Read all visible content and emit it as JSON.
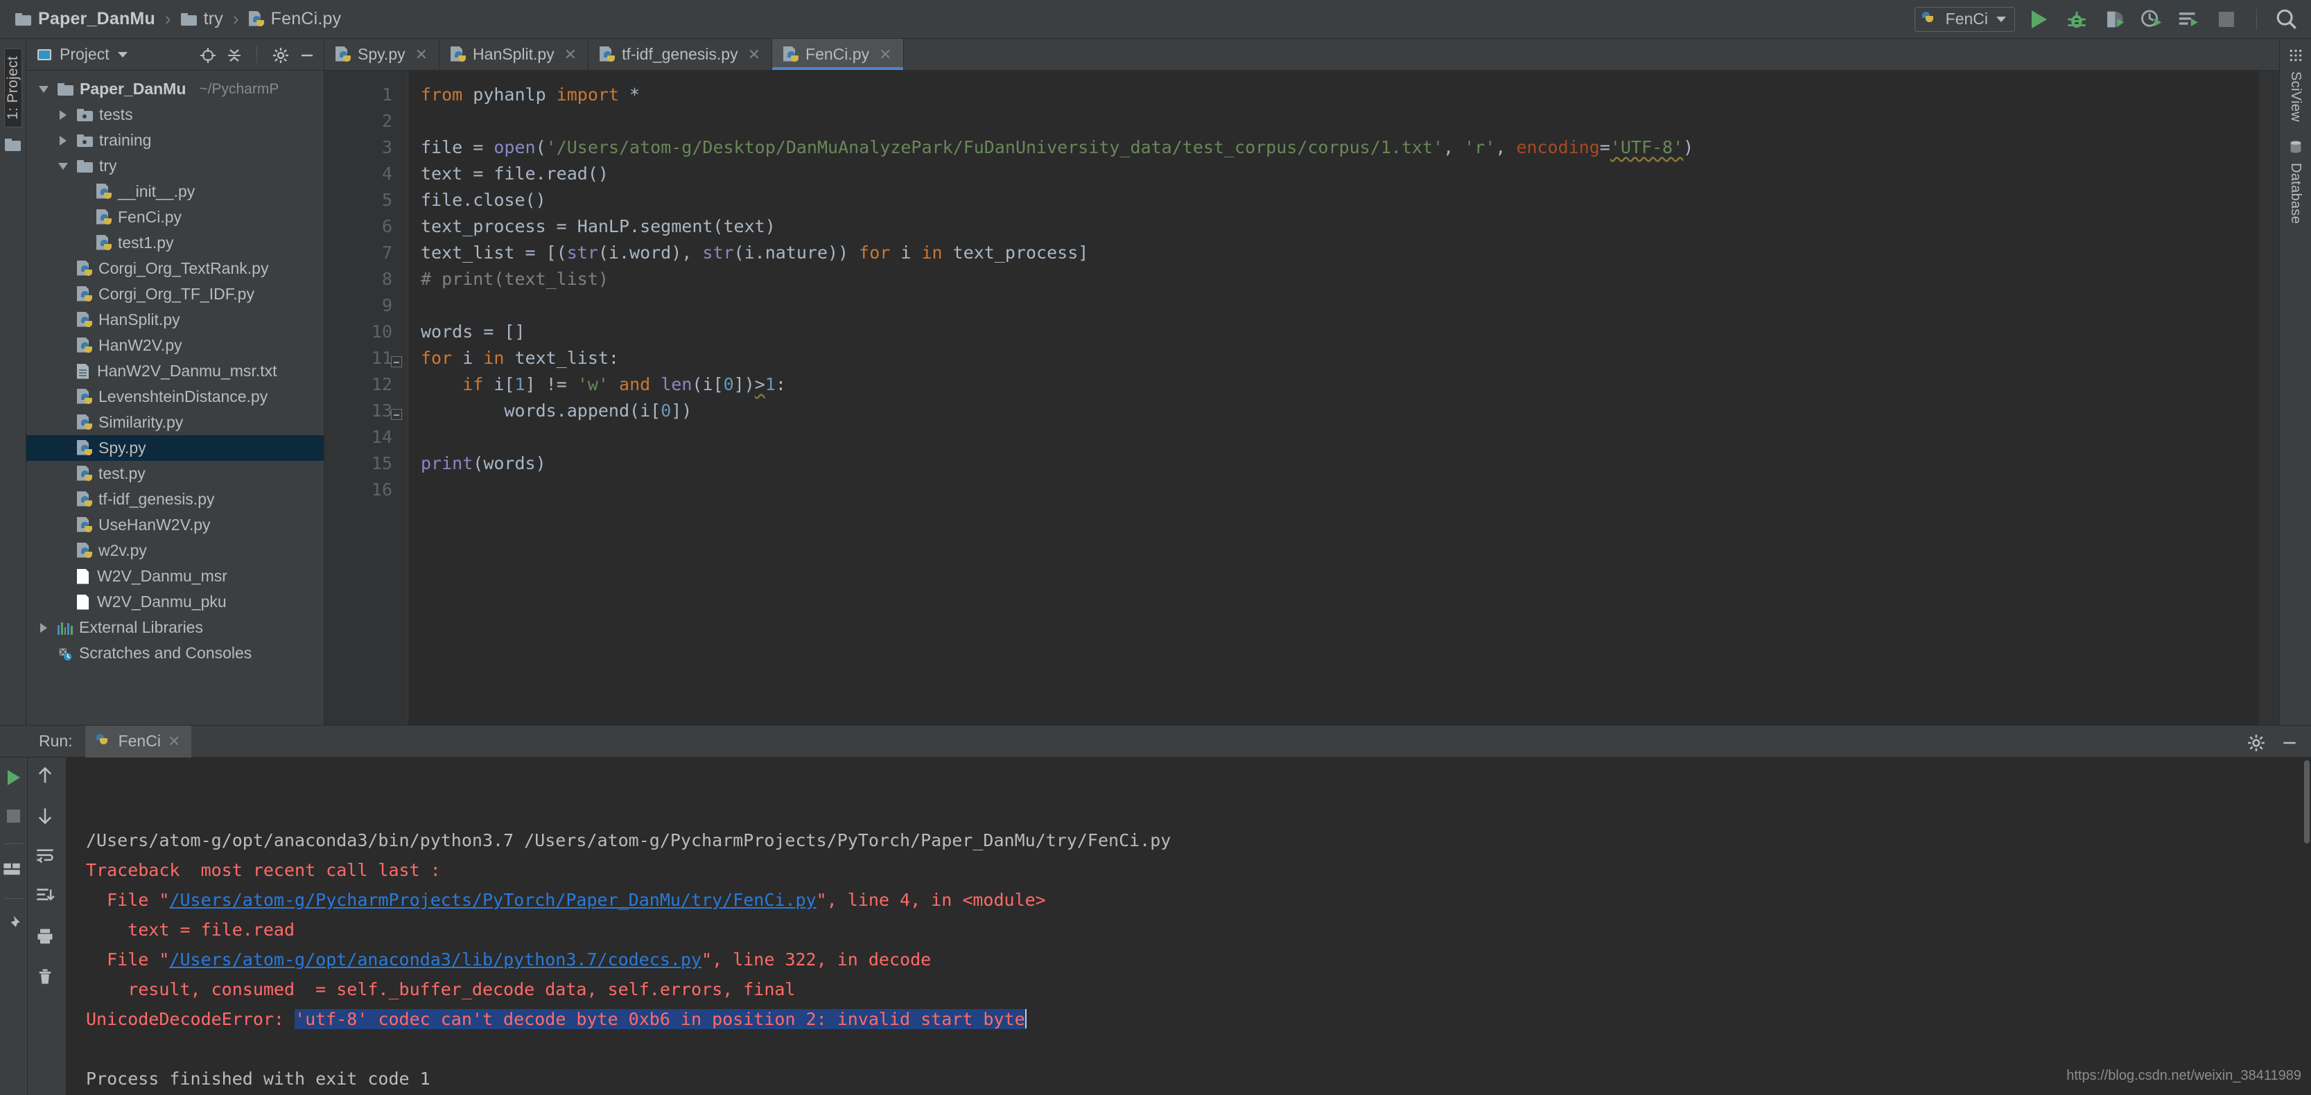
{
  "window": {
    "breadcrumb": [
      {
        "icon": "folder-icon",
        "label": "Paper_DanMu"
      },
      {
        "icon": "folder-icon",
        "label": "try"
      },
      {
        "icon": "python-file-icon",
        "label": "FenCi.py"
      }
    ],
    "breadcrumb_separator": "›"
  },
  "toolbar": {
    "run_config_name": "FenCi",
    "run_config_icon": "python-icon",
    "icons": [
      {
        "name": "run-icon",
        "title": "Run"
      },
      {
        "name": "debug-icon",
        "title": "Debug"
      },
      {
        "name": "coverage-icon",
        "title": "Run with Coverage"
      },
      {
        "name": "profile-icon",
        "title": "Profile"
      },
      {
        "name": "run-with-console-icon",
        "title": "Run"
      },
      {
        "name": "stop-icon",
        "title": "Stop"
      },
      {
        "name": "search-icon",
        "title": "Search Everywhere"
      }
    ]
  },
  "left_strip": {
    "project_label": "1: Project",
    "structure_icon": "folder-icon"
  },
  "project_panel": {
    "title": "Project",
    "header_icons": [
      "target-icon",
      "collapse-all-icon",
      "gear-icon",
      "hide-icon"
    ],
    "tree": [
      {
        "depth": 0,
        "twisty": "down",
        "icon": "folder-icon",
        "label": "Paper_DanMu",
        "suffix": "~/PycharmP",
        "bold": true,
        "selected": false
      },
      {
        "depth": 1,
        "twisty": "right",
        "icon": "source-folder-icon",
        "label": "tests",
        "bold": false,
        "selected": false
      },
      {
        "depth": 1,
        "twisty": "right",
        "icon": "source-folder-icon",
        "label": "training",
        "bold": false,
        "selected": false
      },
      {
        "depth": 1,
        "twisty": "down",
        "icon": "folder-icon",
        "label": "try",
        "bold": false,
        "selected": false
      },
      {
        "depth": 2,
        "twisty": "none",
        "icon": "python-file-icon",
        "label": "__init__.py",
        "bold": false,
        "selected": false
      },
      {
        "depth": 2,
        "twisty": "none",
        "icon": "python-file-icon",
        "label": "FenCi.py",
        "bold": false,
        "selected": false
      },
      {
        "depth": 2,
        "twisty": "none",
        "icon": "python-file-icon",
        "label": "test1.py",
        "bold": false,
        "selected": false
      },
      {
        "depth": 1,
        "twisty": "none",
        "icon": "python-file-icon",
        "label": "Corgi_Org_TextRank.py",
        "bold": false,
        "selected": false
      },
      {
        "depth": 1,
        "twisty": "none",
        "icon": "python-file-icon",
        "label": "Corgi_Org_TF_IDF.py",
        "bold": false,
        "selected": false
      },
      {
        "depth": 1,
        "twisty": "none",
        "icon": "python-file-icon",
        "label": "HanSplit.py",
        "bold": false,
        "selected": false
      },
      {
        "depth": 1,
        "twisty": "none",
        "icon": "python-file-icon",
        "label": "HanW2V.py",
        "bold": false,
        "selected": false
      },
      {
        "depth": 1,
        "twisty": "none",
        "icon": "text-file-icon",
        "label": "HanW2V_Danmu_msr.txt",
        "bold": false,
        "selected": false
      },
      {
        "depth": 1,
        "twisty": "none",
        "icon": "python-file-icon",
        "label": "LevenshteinDistance.py",
        "bold": false,
        "selected": false
      },
      {
        "depth": 1,
        "twisty": "none",
        "icon": "python-file-icon",
        "label": "Similarity.py",
        "bold": false,
        "selected": false
      },
      {
        "depth": 1,
        "twisty": "none",
        "icon": "python-file-icon",
        "label": "Spy.py",
        "bold": false,
        "selected": true
      },
      {
        "depth": 1,
        "twisty": "none",
        "icon": "python-file-icon",
        "label": "test.py",
        "bold": false,
        "selected": false
      },
      {
        "depth": 1,
        "twisty": "none",
        "icon": "python-file-icon",
        "label": "tf-idf_genesis.py",
        "bold": false,
        "selected": false
      },
      {
        "depth": 1,
        "twisty": "none",
        "icon": "python-file-icon",
        "label": "UseHanW2V.py",
        "bold": false,
        "selected": false
      },
      {
        "depth": 1,
        "twisty": "none",
        "icon": "python-file-icon",
        "label": "w2v.py",
        "bold": false,
        "selected": false
      },
      {
        "depth": 1,
        "twisty": "none",
        "icon": "plain-file-icon",
        "label": "W2V_Danmu_msr",
        "bold": false,
        "selected": false
      },
      {
        "depth": 1,
        "twisty": "none",
        "icon": "plain-file-icon",
        "label": "W2V_Danmu_pku",
        "bold": false,
        "selected": false
      },
      {
        "depth": 0,
        "twisty": "right",
        "icon": "library-icon",
        "label": "External Libraries",
        "bold": false,
        "selected": false
      },
      {
        "depth": 0,
        "twisty": "none",
        "icon": "scratches-icon",
        "label": "Scratches and Consoles",
        "bold": false,
        "selected": false
      }
    ]
  },
  "editor": {
    "tabs": [
      {
        "label": "Spy.py",
        "icon": "python-file-icon",
        "active": false,
        "closable": true
      },
      {
        "label": "HanSplit.py",
        "icon": "python-file-icon",
        "active": false,
        "closable": true
      },
      {
        "label": "tf-idf_genesis.py",
        "icon": "python-file-icon",
        "active": false,
        "closable": true
      },
      {
        "label": "FenCi.py",
        "icon": "python-file-icon",
        "active": true,
        "closable": true
      }
    ],
    "line_numbers": [
      "1",
      "2",
      "3",
      "4",
      "5",
      "6",
      "7",
      "8",
      "9",
      "10",
      "11",
      "12",
      "13",
      "14",
      "15",
      "16"
    ],
    "lines": [
      [
        {
          "t": "from ",
          "c": "kw"
        },
        {
          "t": "pyhanlp ",
          "c": ""
        },
        {
          "t": "import",
          "c": "kw"
        },
        {
          "t": " *",
          "c": ""
        }
      ],
      [],
      [
        {
          "t": "file = ",
          "c": ""
        },
        {
          "t": "open",
          "c": "fn"
        },
        {
          "t": "(",
          "c": ""
        },
        {
          "t": "'/Users/atom-g/Desktop/DanMuAnalyzePark/FuDanUniversity_data/test_corpus/corpus/1.txt'",
          "c": "str"
        },
        {
          "t": ", ",
          "c": ""
        },
        {
          "t": "'r'",
          "c": "str"
        },
        {
          "t": ", ",
          "c": ""
        },
        {
          "t": "encoding",
          "c": "kwarg"
        },
        {
          "t": "=",
          "c": ""
        },
        {
          "t": "'UTF-8'",
          "c": "str wavy"
        },
        {
          "t": ")",
          "c": ""
        }
      ],
      [
        {
          "t": "text = file.read()",
          "c": ""
        }
      ],
      [
        {
          "t": "file.close()",
          "c": ""
        }
      ],
      [
        {
          "t": "text_process = HanLP.segment(text)",
          "c": ""
        }
      ],
      [
        {
          "t": "text_list = [(",
          "c": ""
        },
        {
          "t": "str",
          "c": "fn"
        },
        {
          "t": "(i.word), ",
          "c": ""
        },
        {
          "t": "str",
          "c": "fn"
        },
        {
          "t": "(i.nature)) ",
          "c": ""
        },
        {
          "t": "for",
          "c": "kw"
        },
        {
          "t": " i ",
          "c": ""
        },
        {
          "t": "in",
          "c": "kw"
        },
        {
          "t": " text_process]",
          "c": ""
        }
      ],
      [
        {
          "t": "# print(text_list)",
          "c": "cmt"
        }
      ],
      [],
      [
        {
          "t": "words = []",
          "c": ""
        }
      ],
      [
        {
          "t": "for",
          "c": "kw"
        },
        {
          "t": " i ",
          "c": ""
        },
        {
          "t": "in",
          "c": "kw"
        },
        {
          "t": " text_list:",
          "c": ""
        }
      ],
      [
        {
          "t": "    ",
          "c": ""
        },
        {
          "t": "if",
          "c": "kw"
        },
        {
          "t": " i[",
          "c": ""
        },
        {
          "t": "1",
          "c": "num"
        },
        {
          "t": "] != ",
          "c": ""
        },
        {
          "t": "'w'",
          "c": "str"
        },
        {
          "t": " ",
          "c": ""
        },
        {
          "t": "and",
          "c": "kw"
        },
        {
          "t": " ",
          "c": ""
        },
        {
          "t": "len",
          "c": "fn"
        },
        {
          "t": "(i[",
          "c": ""
        },
        {
          "t": "0",
          "c": "num"
        },
        {
          "t": "])",
          "c": ""
        },
        {
          "t": ">",
          "c": "wavy2"
        },
        {
          "t": "1",
          "c": "num"
        },
        {
          "t": ":",
          "c": ""
        }
      ],
      [
        {
          "t": "        words.append(i[",
          "c": ""
        },
        {
          "t": "0",
          "c": "num"
        },
        {
          "t": "])",
          "c": ""
        }
      ],
      [],
      [
        {
          "t": "print",
          "c": "fn"
        },
        {
          "t": "(words)",
          "c": ""
        }
      ],
      []
    ]
  },
  "right_strip": {
    "labels": [
      "SciView",
      "Database"
    ],
    "icons": [
      "sciview-icon",
      "database-icon"
    ]
  },
  "run_panel": {
    "label": "Run:",
    "tab_label": "FenCi",
    "tab_icon": "python-icon",
    "header_right_icons": [
      "gear-icon",
      "hide-icon"
    ],
    "left_tools": [
      {
        "name": "rerun-icon"
      },
      {
        "name": "stop-icon"
      },
      {
        "name": "layout-icon"
      },
      {
        "name": "pin-icon"
      }
    ],
    "left_tools2": [
      {
        "name": "arrow-up-icon"
      },
      {
        "name": "arrow-down-icon"
      },
      {
        "name": "soft-wrap-icon"
      },
      {
        "name": "scroll-to-end-icon"
      },
      {
        "name": "print-icon"
      },
      {
        "name": "trash-icon"
      }
    ],
    "console": [
      {
        "segments": [
          {
            "t": "/Users/atom-g/opt/anaconda3/bin/python3.7 /Users/atom-g/PycharmProjects/PyTorch/Paper_DanMu/try/FenCi.py",
            "c": ""
          }
        ]
      },
      {
        "segments": [
          {
            "t": "Traceback  most recent call last :",
            "c": "err"
          }
        ]
      },
      {
        "segments": [
          {
            "t": "  File \"",
            "c": "err"
          },
          {
            "t": "/Users/atom-g/PycharmProjects/PyTorch/Paper_DanMu/try/FenCi.py",
            "c": "link"
          },
          {
            "t": "\", line 4, in <module>",
            "c": "err"
          }
        ]
      },
      {
        "segments": [
          {
            "t": "    text = file.read",
            "c": "err"
          }
        ]
      },
      {
        "segments": [
          {
            "t": "  File \"",
            "c": "err"
          },
          {
            "t": "/Users/atom-g/opt/anaconda3/lib/python3.7/codecs.py",
            "c": "link"
          },
          {
            "t": "\", line 322, in decode",
            "c": "err"
          }
        ]
      },
      {
        "segments": [
          {
            "t": "    result, consumed  = self._buffer_decode data, self.errors, final",
            "c": "err"
          }
        ]
      },
      {
        "segments": [
          {
            "t": "UnicodeDecodeError: ",
            "c": "err"
          },
          {
            "t": "'utf-8' codec can't decode byte 0xb6 in position 2: invalid start byte",
            "c": "err selhl"
          }
        ]
      },
      {
        "segments": []
      },
      {
        "segments": [
          {
            "t": "Process finished with exit code 1",
            "c": ""
          }
        ]
      }
    ],
    "watermark": "https://blog.csdn.net/weixin_38411989"
  },
  "colors": {
    "chrome": "#3c3f41",
    "editor_bg": "#2b2b2b",
    "gutter_bg": "#313335",
    "accent_blue": "#4a88c7",
    "selection_blue": "#214283",
    "tree_selection": "#0d293e",
    "error_red": "#ff6b68",
    "link_blue": "#287bde",
    "keyword_orange": "#cc7832",
    "string_green": "#6a8759",
    "number_blue": "#6897bb",
    "function_purple": "#8888c6",
    "comment_gray": "#808080",
    "run_green": "#59a869"
  }
}
